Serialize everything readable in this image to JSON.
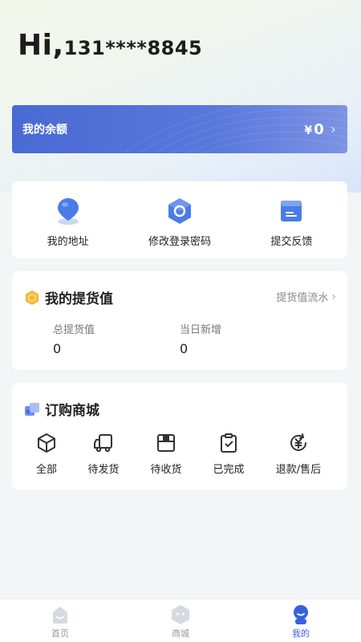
{
  "header": {
    "greeting": "Hi,",
    "phone": "131****8845"
  },
  "balance": {
    "label": "我的余额",
    "currency": "¥",
    "amount": "0"
  },
  "quick_actions": [
    {
      "label": "我的地址",
      "icon": "location-pin-icon"
    },
    {
      "label": "修改登录密码",
      "icon": "password-hexagon-icon"
    },
    {
      "label": "提交反馈",
      "icon": "feedback-card-icon"
    }
  ],
  "pickup": {
    "title": "我的提货值",
    "flow_link": "提货值流水",
    "total_label": "总提货值",
    "total_value": "0",
    "today_label": "当日新增",
    "today_value": "0"
  },
  "mall": {
    "title": "订购商城",
    "orders": [
      {
        "label": "全部",
        "icon": "cube-icon"
      },
      {
        "label": "待发货",
        "icon": "truck-icon"
      },
      {
        "label": "待收货",
        "icon": "box-icon"
      },
      {
        "label": "已完成",
        "icon": "clipboard-check-icon"
      },
      {
        "label": "退款/售后",
        "icon": "refund-icon"
      }
    ]
  },
  "tabbar": {
    "items": [
      {
        "label": "首页",
        "icon": "home-icon",
        "active": false
      },
      {
        "label": "商城",
        "icon": "store-icon",
        "active": false
      },
      {
        "label": "我的",
        "icon": "profile-icon",
        "active": true
      }
    ]
  },
  "colors": {
    "accent": "#3a5fe0",
    "balance_start": "#4a6ad4",
    "balance_end": "#7d93e3"
  }
}
